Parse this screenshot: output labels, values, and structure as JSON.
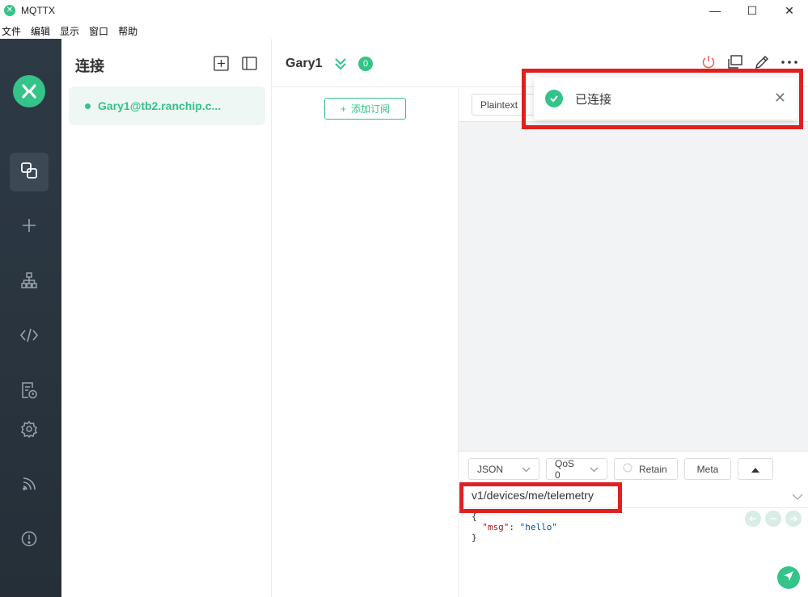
{
  "window": {
    "title": "MQTTX",
    "minimize_glyph": "—",
    "maximize_glyph": "☐",
    "close_glyph": "✕"
  },
  "menu": [
    "文件",
    "编辑",
    "显示",
    "窗口",
    "帮助"
  ],
  "nav": {
    "icons": [
      "connections-icon",
      "plus-icon",
      "network-icon",
      "code-icon",
      "log-icon",
      "gear-icon",
      "feed-icon",
      "info-icon"
    ]
  },
  "connections": {
    "title": "连接",
    "items": [
      {
        "name": "Gary1@tb2.ranchip.c..."
      }
    ]
  },
  "header": {
    "name": "Gary1",
    "count": "0"
  },
  "subscriptions": {
    "add_label": "添加订阅",
    "add_glyph": "+"
  },
  "messages": {
    "format": "Plaintext"
  },
  "toast": {
    "text": "已连接",
    "close_glyph": "✕"
  },
  "publish": {
    "format": "JSON",
    "qos": "QoS 0",
    "retain_label": "Retain",
    "meta_label": "Meta",
    "topic": "v1/devices/me/telemetry",
    "payload_open": "{",
    "payload_key": "\"msg\"",
    "payload_colon": ": ",
    "payload_value": "\"hello\"",
    "payload_close": "}"
  },
  "colors": {
    "accent": "#34c388",
    "nav_bg": "#2d3a46",
    "highlight": "#e02020"
  }
}
